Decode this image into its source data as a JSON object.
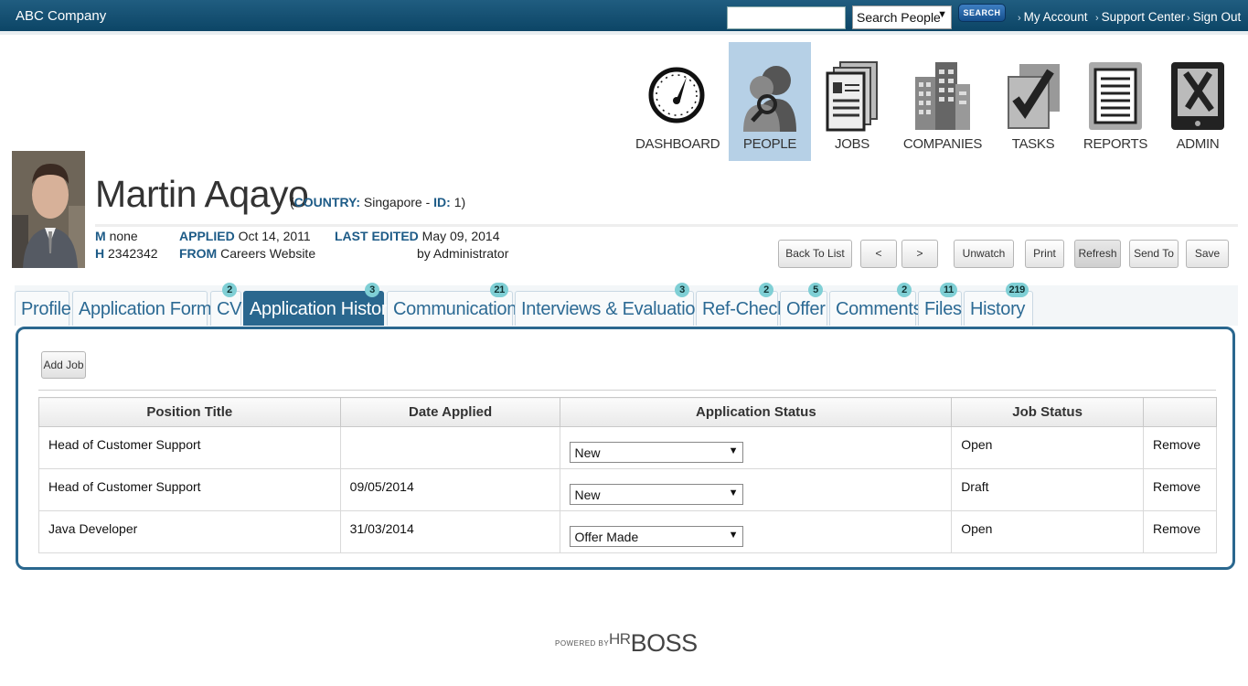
{
  "header": {
    "company": "ABC Company",
    "search_placeholder": "",
    "search_scope": "Search People",
    "search_button": "SEARCH",
    "links": [
      "My Account",
      "Support Center",
      "Sign Out"
    ]
  },
  "nav": [
    {
      "label": "DASHBOARD",
      "icon": "dashboard-gauge-icon"
    },
    {
      "label": "PEOPLE",
      "icon": "people-icon",
      "active": true
    },
    {
      "label": "JOBS",
      "icon": "jobs-icon"
    },
    {
      "label": "COMPANIES",
      "icon": "companies-icon"
    },
    {
      "label": "TASKS",
      "icon": "tasks-icon"
    },
    {
      "label": "REPORTS",
      "icon": "reports-icon"
    },
    {
      "label": "ADMIN",
      "icon": "admin-icon"
    }
  ],
  "person": {
    "name": "Martin Aqayo",
    "meta_open": "(",
    "country_label": "COUNTRY:",
    "country": "Singapore",
    "id_sep": "-",
    "id_label": "ID:",
    "id": "1)",
    "m_label": "M",
    "m_value": "none",
    "h_label": "H",
    "h_value": "2342342",
    "applied_label": "APPLIED",
    "applied_value": "Oct 14, 2011",
    "from_label": "FROM",
    "from_value": "Careers Website",
    "edited_label": "LAST EDITED",
    "edited_value": "May 09, 2014",
    "edited_by": "by Administrator"
  },
  "actions": {
    "back": "Back To List",
    "prev": "<",
    "next": ">",
    "unwatch": "Unwatch",
    "print": "Print",
    "refresh": "Refresh",
    "send_to": "Send To",
    "save": "Save"
  },
  "tabs": [
    {
      "label": "Profile",
      "badge": ""
    },
    {
      "label": "Application Forms",
      "badge": ""
    },
    {
      "label": "CV",
      "badge": "2"
    },
    {
      "label": "Application History",
      "badge": "3",
      "active": true
    },
    {
      "label": "Communication",
      "badge": "21"
    },
    {
      "label": "Interviews & Evaluations",
      "badge": "3"
    },
    {
      "label": "Ref-Check",
      "badge": "2"
    },
    {
      "label": "Offer",
      "badge": "5"
    },
    {
      "label": "Comments",
      "badge": "2"
    },
    {
      "label": "Files",
      "badge": "11"
    },
    {
      "label": "History",
      "badge": "219"
    }
  ],
  "history": {
    "add_job": "Add Job",
    "columns": [
      "Position Title",
      "Date Applied",
      "Application Status",
      "Job Status",
      ""
    ],
    "rows": [
      {
        "position": "Head of Customer Support",
        "date": "",
        "status": "New",
        "job_status": "Open",
        "action": "Remove"
      },
      {
        "position": "Head of Customer Support",
        "date": "09/05/2014",
        "status": "New",
        "job_status": "Draft",
        "action": "Remove"
      },
      {
        "position": "Java Developer",
        "date": "31/03/2014",
        "status": "Offer Made",
        "job_status": "Open",
        "action": "Remove"
      }
    ]
  },
  "footer": {
    "powered_by": "POWERED BY",
    "brand_prefix": "HR",
    "brand": "BOSS"
  },
  "colors": {
    "topbar": "#0f4c6e",
    "accent": "#2a678e",
    "nav_active": "#b6d0e6",
    "badge": "#7fcfd5"
  }
}
